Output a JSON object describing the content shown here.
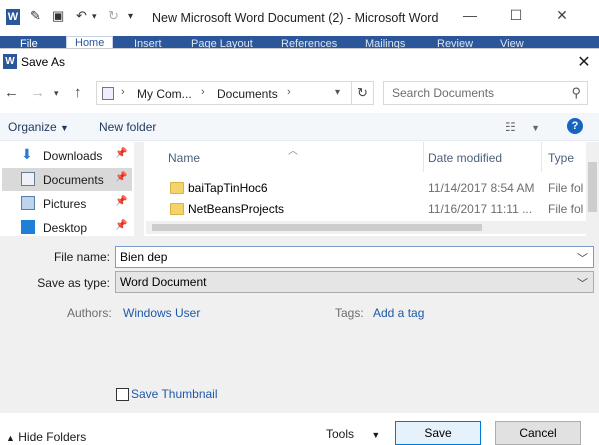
{
  "word": {
    "app_icon": "W",
    "title": "New Microsoft Word Document (2)  -  Microsoft Word",
    "ribbon_tabs": [
      "File",
      "Home",
      "Insert",
      "Page Layout",
      "References",
      "Mailings",
      "Review",
      "View"
    ]
  },
  "dialog": {
    "title": "Save As",
    "address": {
      "crumbs": [
        "My Com...",
        "Documents"
      ]
    },
    "search_placeholder": "Search Documents",
    "toolbar": {
      "organize": "Organize",
      "new_folder": "New folder"
    },
    "nav_items": [
      {
        "label": "Downloads",
        "icon": "download-arrow-icon"
      },
      {
        "label": "Documents",
        "icon": "documents-icon",
        "selected": true
      },
      {
        "label": "Pictures",
        "icon": "pictures-icon"
      },
      {
        "label": "Desktop",
        "icon": "desktop-icon"
      }
    ],
    "columns": {
      "name": "Name",
      "date": "Date modified",
      "type": "Type"
    },
    "files": [
      {
        "name": "baiTapTinHoc6",
        "date": "11/14/2017 8:54 AM",
        "type": "File fol"
      },
      {
        "name": "NetBeansProjects",
        "date": "11/16/2017 11:11 ...",
        "type": "File fol"
      }
    ],
    "form": {
      "file_name_label": "File name:",
      "file_name_value": "Bien dep",
      "save_as_type_label": "Save as type:",
      "save_as_type_value": "Word Document",
      "authors_label": "Authors:",
      "authors_value": "Windows User",
      "tags_label": "Tags:",
      "tags_value": "Add a tag",
      "save_thumbnail": "Save Thumbnail",
      "hide_folders": "Hide Folders",
      "tools": "Tools",
      "save": "Save",
      "cancel": "Cancel"
    }
  }
}
